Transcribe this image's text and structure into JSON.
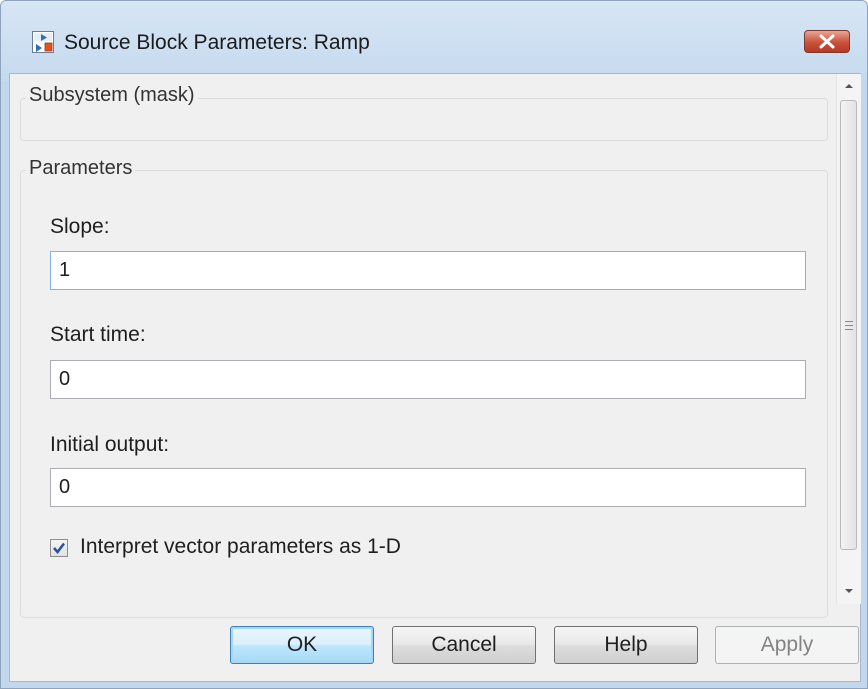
{
  "window": {
    "title": "Source Block Parameters: Ramp",
    "close_icon": "close-icon"
  },
  "subsystem_group": {
    "legend": "Subsystem (mask)"
  },
  "parameters_group": {
    "legend": "Parameters",
    "slope": {
      "label": "Slope:",
      "value": "1"
    },
    "start_time": {
      "label": "Start time:",
      "value": "0"
    },
    "initial_output": {
      "label": "Initial output:",
      "value": "0"
    },
    "interpret_vector": {
      "label": "Interpret vector parameters as 1-D",
      "checked": true
    }
  },
  "buttons": {
    "ok": "OK",
    "cancel": "Cancel",
    "help": "Help",
    "apply": "Apply"
  },
  "colors": {
    "titlebar": "#c5d9ee",
    "close_button": "#c9503b",
    "default_button": "#bee6fd",
    "focus_border": "#7eb4ea"
  }
}
